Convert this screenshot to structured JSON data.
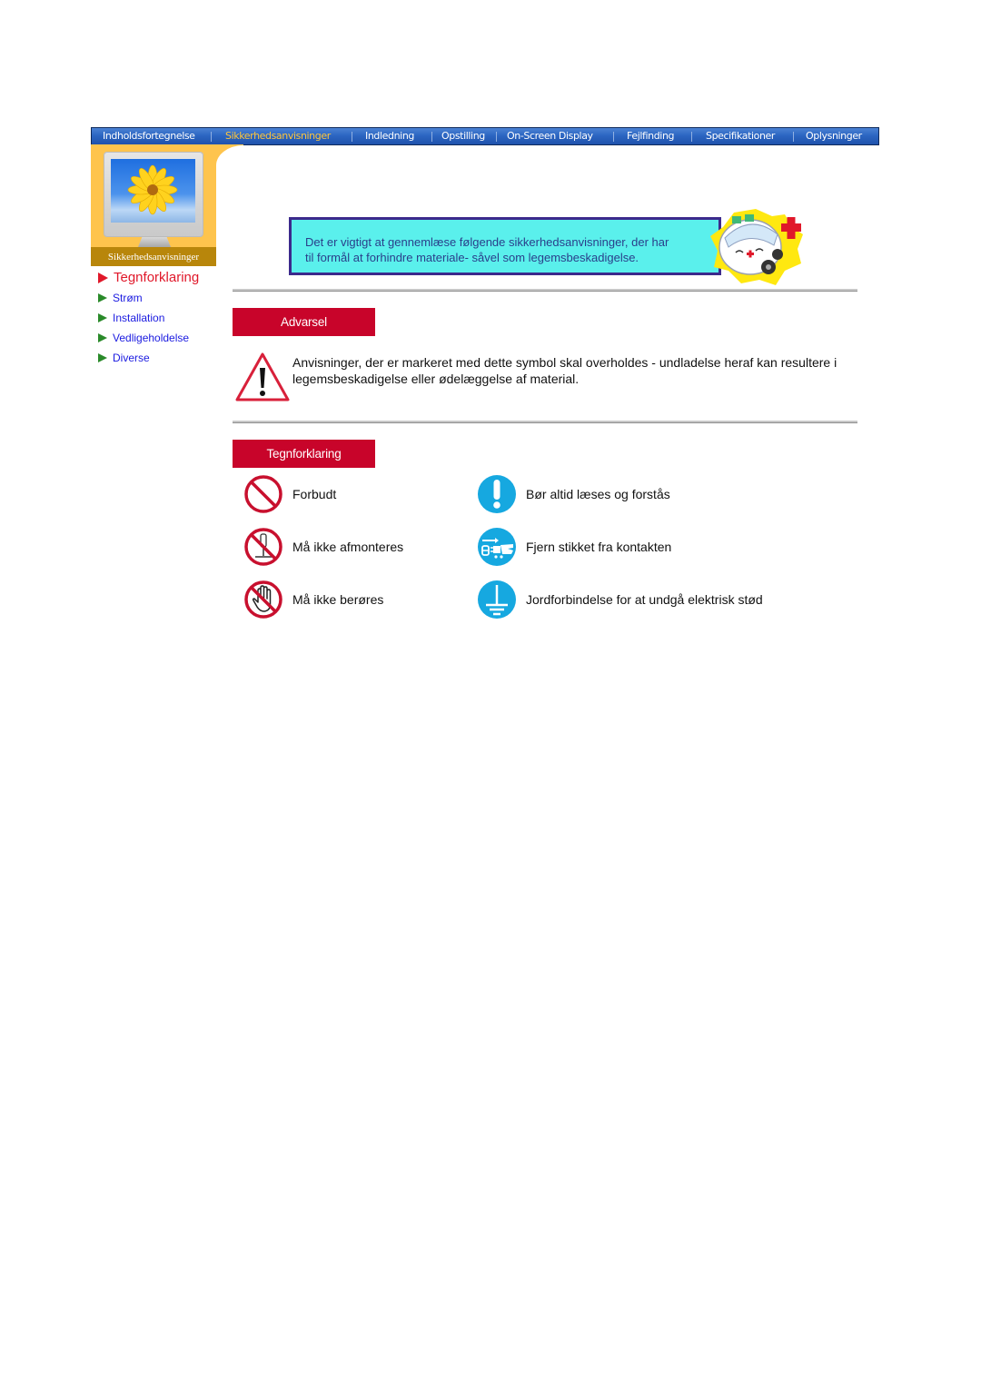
{
  "nav": {
    "items": [
      {
        "label": "Indholdsfortegnelse",
        "active": false
      },
      {
        "label": "Sikkerhedsanvisninger",
        "active": true
      },
      {
        "label": "Indledning",
        "active": false
      },
      {
        "label": "Opstilling",
        "active": false
      },
      {
        "label": "On-Screen Display",
        "active": false
      },
      {
        "label": "Fejlfinding",
        "active": false
      },
      {
        "label": "Specifikationer",
        "active": false
      },
      {
        "label": "Oplysninger",
        "active": false
      }
    ]
  },
  "sidebar": {
    "section_label": "Sikkerhedsanvisninger",
    "items": [
      {
        "label": "Tegnforklaring",
        "current": true,
        "icon": "triangle-right-red"
      },
      {
        "label": "Strøm",
        "current": false,
        "icon": "triangle-right-green"
      },
      {
        "label": "Installation",
        "current": false,
        "icon": "triangle-right-green"
      },
      {
        "label": "Vedligeholdelse",
        "current": false,
        "icon": "triangle-right-green"
      },
      {
        "label": "Diverse",
        "current": false,
        "icon": "triangle-right-green"
      }
    ]
  },
  "banner": {
    "line1": "Det er vigtigt at gennemlæse følgende sikkerhedsanvisninger, der har",
    "line2": "til formål at forhindre materiale- såvel som legemsbeskadigelse.",
    "icon": "ambulance-icon"
  },
  "warning": {
    "heading": "Advarsel",
    "icon": "warning-triangle-icon",
    "text": "Anvisninger, der er markeret med dette symbol skal overholdes - undladelse heraf kan resultere i legemsbeskadigelse eller ødelæggelse af material."
  },
  "legend": {
    "heading": "Tegnforklaring",
    "items": [
      {
        "label": "Forbudt",
        "icon": "prohibited-icon"
      },
      {
        "label": "Bør altid læses og forstås",
        "icon": "exclamation-circle-icon"
      },
      {
        "label": "Må ikke afmonteres",
        "icon": "no-disassembly-icon"
      },
      {
        "label": "Fjern stikket fra kontakten",
        "icon": "unplug-icon"
      },
      {
        "label": "Må ikke berøres",
        "icon": "no-touch-icon"
      },
      {
        "label": "Jordforbindelse for at undgå elektrisk stød",
        "icon": "ground-icon"
      }
    ]
  },
  "colors": {
    "nav_active": "#ffc63c",
    "section_header": "#c8042a",
    "sidebar_current": "#e0182a",
    "sidebar_link": "#1a1ae0",
    "banner_bg": "#5af0ec",
    "info_icon": "#16a8e0"
  }
}
